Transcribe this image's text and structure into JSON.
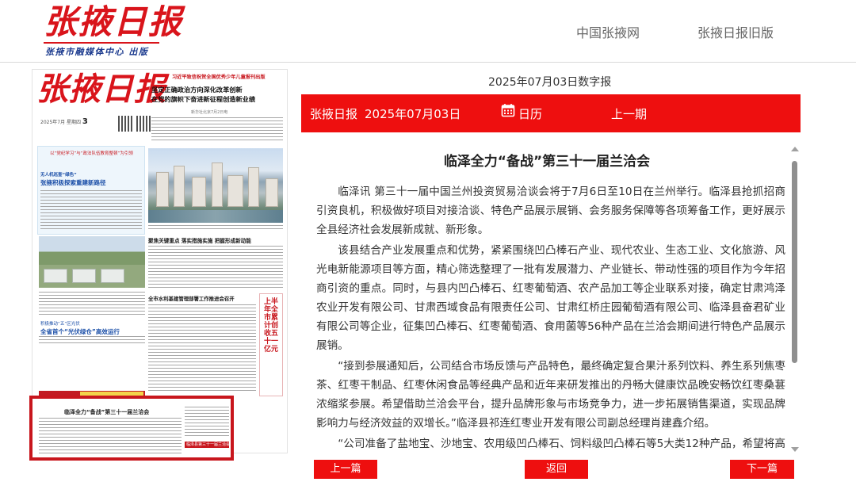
{
  "header": {
    "logo_text": "张掖日报",
    "logo_subtitle": "张掖市融媒体中心 出版",
    "nav": [
      {
        "label": "中国张掖网"
      },
      {
        "label": "张掖日报旧版"
      }
    ]
  },
  "paper_page": {
    "masthead": "张掖日报",
    "kicker": "习近平致信祝贺全国优秀少年儿童报刊出版",
    "headline_1": "坚定正确政治方向深化改革创新",
    "headline_2": "在党的旗帜下奋进新征程创造新业绩",
    "issue_day": "3",
    "issue_label": "2025年7月 星期四",
    "byline": "新华社北京7月2日电",
    "left_box_intro": "以“党纪学习”与“政法队伍教育整顿”为引领",
    "left_box_title": "张掖积极探索重建新路径",
    "left_box_kicker": "无人机巡查“绿色”",
    "mid_headline": "聚焦关键重点 落实措施实施 把握形成新动能",
    "mid_headline_2": "全市水利基建管理部署工作推进会召开",
    "left_story_kicker": "积极推动“五”区光伏",
    "left_story_title": "全省首个“光伏绿仓”高效运行",
    "vertical_headline": "上半年全市累计创收五十一亿元",
    "selected_story_title": "临泽全力“备战”第三十一届兰洽会",
    "selected_story_badge": "临泽县第三十一届兰洽会"
  },
  "toolbar": {
    "edition_date": "2025年07月03日数字报",
    "paper_name": "张掖日报",
    "paper_date": "2025年07月03日",
    "calendar_label": "日历",
    "prev_issue_label": "上一期"
  },
  "article": {
    "title": "临泽全力“备战”第三十一届兰洽会",
    "paragraphs": [
      "临泽讯 第三十一届中国兰州投资贸易洽谈会将于7月6日至10日在兰州举行。临泽县抢抓招商引资良机，积极做好项目对接洽谈、特色产品展示展销、会务服务保障等各项筹备工作，更好展示全县经济社会发展新成就、新形象。",
      "该县结合产业发展重点和优势，紧紧围绕凹凸棒石产业、现代农业、生态工业、文化旅游、风光电新能源项目等方面，精心筛选整理了一批有发展潜力、产业链长、带动性强的项目作为今年招商引资的重点。同时，与县内凹凸棒石、红枣葡萄酒、农产品加工等企业联系对接，确定甘肃鸿泽农业开发有限公司、甘肃西域食品有限责任公司、甘肃红桥庄园葡萄酒有限公司、临泽县奋君矿业有限公司等企业，征集凹凸棒石、红枣葡萄酒、食用菌等56种产品在兰洽会期间进行特色产品展示展销。",
      "“接到参展通知后，公司结合市场反馈与产品特色，最终确定复合果汁系列饮料、养生系列焦枣茶、红枣干制品、红枣休闲食品等经典产品和近年来研发推出的丹畅大健康饮品晚安畅饮红枣桑葚浓缩浆参展。希望借助兰洽会平台，提升品牌形象与市场竞争力，进一步拓展销售渠道，实现品牌影响力与经济效益的双增长。”临泽县祁连红枣业开发有限公司副总经理肖建鑫介绍。",
      "“公司准备了盐地宝、沙地宝、农用级凹凸棒石、饲料级凹凸棒石等5大类12种产品，希望将高值化新材料、新产品在兰洽会上展示给全国各地客商，将临泽凹凸棒石推向更广阔的市场。”临泽县奋君矿业有限公司负责人介绍。"
    ]
  },
  "footer_nav": {
    "prev_label": "上一篇",
    "back_label": "返回",
    "next_label": "下一篇"
  },
  "colors": {
    "brand_red": "#ee0f0f",
    "logo_red": "#d9141b",
    "logo_blue": "#1b3a8e"
  },
  "icons": [
    "calendar-icon",
    "scroll-up-icon",
    "scroll-down-icon"
  ]
}
